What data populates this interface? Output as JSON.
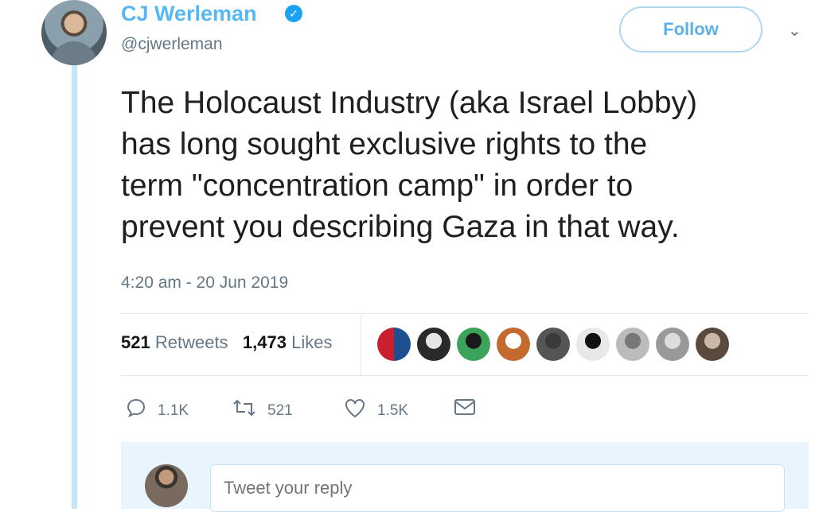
{
  "user": {
    "name": "CJ Werleman",
    "handle": "@cjwerleman",
    "verified_icon": "verified-badge-icon"
  },
  "follow_label": "Follow",
  "tweet": {
    "lines": [
      "The Holocaust Industry (aka Israel Lobby)",
      "has long sought exclusive rights to the",
      "term \"concentration camp\" in order to",
      "prevent you describing Gaza in that way."
    ],
    "timestamp": "4:20 am - 20 Jun 2019"
  },
  "stats": {
    "retweets_count": "521",
    "retweets_label": "Retweets",
    "likes_count": "1,473",
    "likes_label": "Likes"
  },
  "likers": [
    {
      "color": "#c8202f",
      "color2": "#1d4f91"
    },
    {
      "color": "#e6e6e6",
      "color2": "#2a2a2a"
    },
    {
      "color": "#1a1a1a",
      "color2": "#3ca35a"
    },
    {
      "color": "#ffffff",
      "color2": "#c46a2e"
    },
    {
      "color": "#3a3a3a",
      "color2": "#555555"
    },
    {
      "color": "#111111",
      "color2": "#e8e8e8"
    },
    {
      "color": "#777777",
      "color2": "#bbbbbb"
    },
    {
      "color": "#dddddd",
      "color2": "#999999"
    },
    {
      "color": "#c9b8a8",
      "color2": "#5a4a3e"
    }
  ],
  "actions": {
    "replies": "1.1K",
    "retweets": "521",
    "likes": "1.5K"
  },
  "reply_placeholder": "Tweet your reply",
  "colors": {
    "accent": "#1da1f2",
    "thread_line": "#c4e7f8"
  }
}
